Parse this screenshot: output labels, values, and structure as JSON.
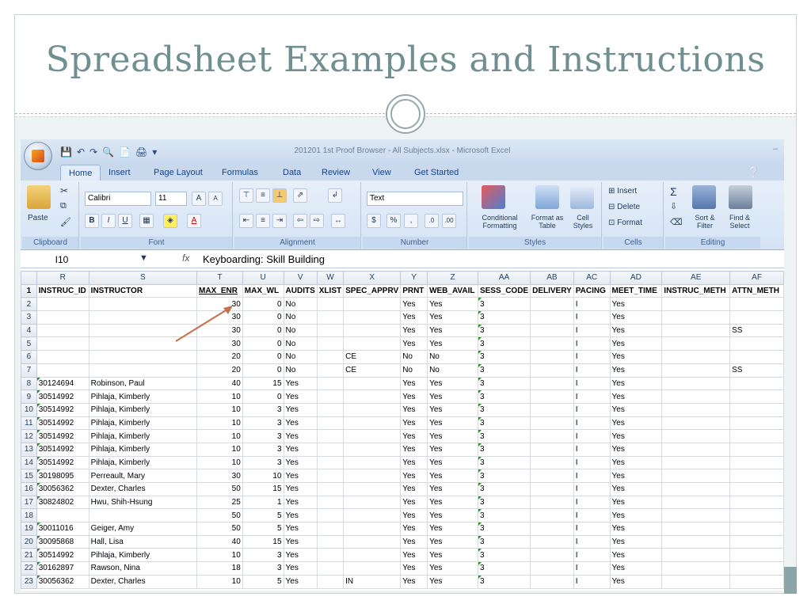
{
  "slide": {
    "title": "Spreadsheet Examples and Instructions"
  },
  "excel": {
    "window_title": "201201 1st Proof Browser - All Subjects.xlsx - Microsoft Excel",
    "tabs": [
      "Home",
      "Insert",
      "Page Layout",
      "Formulas",
      "Data",
      "Review",
      "View",
      "Get Started"
    ],
    "ribbon": {
      "clipboard": {
        "label": "Clipboard",
        "paste": "Paste"
      },
      "font": {
        "label": "Font",
        "font_name": "Calibri",
        "font_size": "11"
      },
      "alignment": {
        "label": "Alignment"
      },
      "number": {
        "label": "Number",
        "format": "Text"
      },
      "styles": {
        "label": "Styles",
        "conditional": "Conditional Formatting",
        "format_table": "Format as Table",
        "cell_styles": "Cell Styles"
      },
      "cells": {
        "label": "Cells",
        "insert": "Insert",
        "delete": "Delete",
        "format": "Format"
      },
      "editing": {
        "label": "Editing",
        "sort": "Sort & Filter",
        "find": "Find & Select"
      }
    },
    "formula_bar": {
      "name_box": "I10",
      "fx": "fx",
      "content": "Keyboarding: Skill Building"
    },
    "columns": [
      "R",
      "S",
      "T",
      "U",
      "V",
      "W",
      "X",
      "Y",
      "Z",
      "AA",
      "AB",
      "AC",
      "AD",
      "AE",
      "AF"
    ],
    "header_row": [
      "INSTRUC_ID",
      "INSTRUCTOR",
      "MAX_ENR",
      "MAX_WL",
      "AUDITS",
      "XLIST",
      "SPEC_APPRV",
      "PRNT",
      "WEB_AVAIL",
      "SESS_CODE",
      "DELIVERY",
      "PACING",
      "MEET_TIME",
      "INSTRUC_METH",
      "ATTN_METH"
    ],
    "rows": [
      [
        "2",
        "",
        "",
        "30",
        "0",
        "No",
        "",
        "",
        "Yes",
        "Yes",
        "3",
        "",
        "I",
        "Yes",
        "",
        ""
      ],
      [
        "3",
        "",
        "",
        "30",
        "0",
        "No",
        "",
        "",
        "Yes",
        "Yes",
        "3",
        "",
        "I",
        "Yes",
        "",
        ""
      ],
      [
        "4",
        "",
        "",
        "30",
        "0",
        "No",
        "",
        "",
        "Yes",
        "Yes",
        "3",
        "",
        "I",
        "Yes",
        "",
        "SS"
      ],
      [
        "5",
        "",
        "",
        "30",
        "0",
        "No",
        "",
        "",
        "Yes",
        "Yes",
        "3",
        "",
        "I",
        "Yes",
        "",
        ""
      ],
      [
        "6",
        "",
        "",
        "20",
        "0",
        "No",
        "",
        "CE",
        "No",
        "No",
        "3",
        "",
        "I",
        "Yes",
        "",
        ""
      ],
      [
        "7",
        "",
        "",
        "20",
        "0",
        "No",
        "",
        "CE",
        "No",
        "No",
        "3",
        "",
        "I",
        "Yes",
        "",
        "SS"
      ],
      [
        "8",
        "30124694",
        "Robinson, Paul",
        "40",
        "15",
        "Yes",
        "",
        "",
        "Yes",
        "Yes",
        "3",
        "",
        "I",
        "Yes",
        "",
        ""
      ],
      [
        "9",
        "30514992",
        "Pihlaja, Kimberly",
        "10",
        "0",
        "Yes",
        "",
        "",
        "Yes",
        "Yes",
        "3",
        "",
        "I",
        "Yes",
        "",
        ""
      ],
      [
        "10",
        "30514992",
        "Pihlaja, Kimberly",
        "10",
        "3",
        "Yes",
        "",
        "",
        "Yes",
        "Yes",
        "3",
        "",
        "I",
        "Yes",
        "",
        ""
      ],
      [
        "11",
        "30514992",
        "Pihlaja, Kimberly",
        "10",
        "3",
        "Yes",
        "",
        "",
        "Yes",
        "Yes",
        "3",
        "",
        "I",
        "Yes",
        "",
        ""
      ],
      [
        "12",
        "30514992",
        "Pihlaja, Kimberly",
        "10",
        "3",
        "Yes",
        "",
        "",
        "Yes",
        "Yes",
        "3",
        "",
        "I",
        "Yes",
        "",
        ""
      ],
      [
        "13",
        "30514992",
        "Pihlaja, Kimberly",
        "10",
        "3",
        "Yes",
        "",
        "",
        "Yes",
        "Yes",
        "3",
        "",
        "I",
        "Yes",
        "",
        ""
      ],
      [
        "14",
        "30514992",
        "Pihlaja, Kimberly",
        "10",
        "3",
        "Yes",
        "",
        "",
        "Yes",
        "Yes",
        "3",
        "",
        "I",
        "Yes",
        "",
        ""
      ],
      [
        "15",
        "30198095",
        "Perreault, Mary",
        "30",
        "10",
        "Yes",
        "",
        "",
        "Yes",
        "Yes",
        "3",
        "",
        "I",
        "Yes",
        "",
        ""
      ],
      [
        "16",
        "30056362",
        "Dexter, Charles",
        "50",
        "15",
        "Yes",
        "",
        "",
        "Yes",
        "Yes",
        "3",
        "",
        "I",
        "Yes",
        "",
        ""
      ],
      [
        "17",
        "30824802",
        "Hwu, Shih-Hsung",
        "25",
        "1",
        "Yes",
        "",
        "",
        "Yes",
        "Yes",
        "3",
        "",
        "I",
        "Yes",
        "",
        ""
      ],
      [
        "18",
        "",
        "",
        "50",
        "5",
        "Yes",
        "",
        "",
        "Yes",
        "Yes",
        "3",
        "",
        "I",
        "Yes",
        "",
        ""
      ],
      [
        "19",
        "30011016",
        "Geiger, Amy",
        "50",
        "5",
        "Yes",
        "",
        "",
        "Yes",
        "Yes",
        "3",
        "",
        "I",
        "Yes",
        "",
        ""
      ],
      [
        "20",
        "30095868",
        "Hall, Lisa",
        "40",
        "15",
        "Yes",
        "",
        "",
        "Yes",
        "Yes",
        "3",
        "",
        "I",
        "Yes",
        "",
        ""
      ],
      [
        "21",
        "30514992",
        "Pihlaja, Kimberly",
        "10",
        "3",
        "Yes",
        "",
        "",
        "Yes",
        "Yes",
        "3",
        "",
        "I",
        "Yes",
        "",
        ""
      ],
      [
        "22",
        "30162897",
        "Rawson, Nina",
        "18",
        "3",
        "Yes",
        "",
        "",
        "Yes",
        "Yes",
        "3",
        "",
        "I",
        "Yes",
        "",
        ""
      ],
      [
        "23",
        "30056362",
        "Dexter, Charles",
        "10",
        "5",
        "Yes",
        "",
        "IN",
        "Yes",
        "Yes",
        "3",
        "",
        "I",
        "Yes",
        "",
        ""
      ]
    ]
  }
}
